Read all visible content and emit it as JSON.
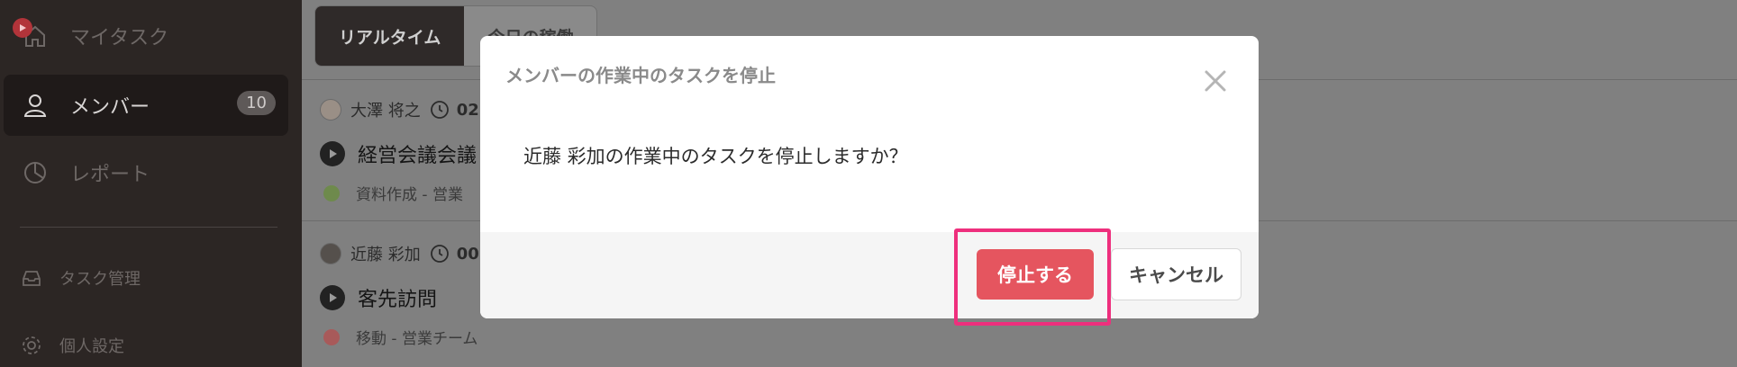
{
  "sidebar": {
    "my_tasks": "マイタスク",
    "members": "メンバー",
    "members_count": "10",
    "reports": "レポート",
    "task_management": "タスク管理",
    "personal_settings": "個人設定"
  },
  "tabs": [
    {
      "label": "リアルタイム"
    },
    {
      "label": "今日の稼働"
    }
  ],
  "rows": [
    {
      "member": "大澤 将之",
      "time": "02",
      "task": "経営会議会議",
      "category": "資料作成 - 営業",
      "category_color": "#6e8a4c"
    },
    {
      "member": "近藤 彩加",
      "time": "00",
      "task": "客先訪問",
      "category": "移動 - 営業チーム",
      "category_color": "#a85a5a"
    }
  ],
  "modal": {
    "title": "メンバーの作業中のタスクを停止",
    "message": "近藤 彩加の作業中のタスクを停止しますか？",
    "confirm_label": "停止する",
    "cancel_label": "キャンセル"
  },
  "colors": {
    "confirm_button": "#e5555f",
    "highlight_box": "#ee2f7d"
  }
}
